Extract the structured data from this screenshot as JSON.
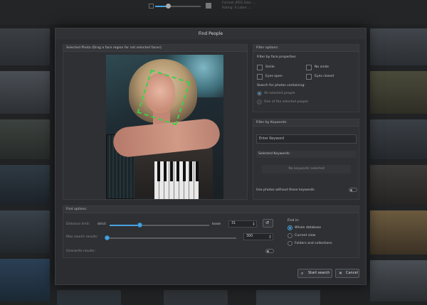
{
  "background": {
    "info_lines": [
      "Format: JPEG   Size: ...",
      "Rating: 0   Label: ..."
    ]
  },
  "dialog": {
    "title": "Find People",
    "photo_panel": {
      "header": "Selected Photo (Drag a face region for not selected faces):"
    },
    "filter_options": {
      "header": "Filter options:",
      "face_props_label": "Filter by face properties",
      "checkboxes": [
        {
          "label": "Smile",
          "checked": false
        },
        {
          "label": "No smile",
          "checked": false
        },
        {
          "label": "Eyes open",
          "checked": false
        },
        {
          "label": "Eyes closed",
          "checked": false
        }
      ],
      "search_label": "Search for photos containing:",
      "radios": [
        {
          "label": "All selected people",
          "selected": true
        },
        {
          "label": "One of the selected people",
          "selected": false
        }
      ]
    },
    "keywords": {
      "header": "Filter by Keywords:",
      "input_placeholder": "Enter Keyword",
      "selected_label": "Selected Keywords:",
      "empty_text": "No keywords selected",
      "toggle_label": "Use photos without these keywords",
      "toggle_on": false
    },
    "find_options": {
      "header": "Find options:",
      "distance_label": "Distance limit:",
      "strict_label": "strict",
      "loose_label": "loose",
      "distance_value": "31",
      "distance_fraction": 0.31,
      "max_results_label": "Max search results:",
      "max_results_value": "300",
      "max_results_fraction": 0.0,
      "overwrite_label": "Overwrite results:",
      "overwrite_on": false,
      "find_in_label": "Find in:",
      "find_in": [
        {
          "label": "Whole database",
          "selected": true
        },
        {
          "label": "Current view",
          "selected": false
        },
        {
          "label": "Folders and collections",
          "selected": false
        }
      ]
    },
    "buttons": {
      "start_label": "Start search",
      "cancel_label": "Cancel"
    }
  }
}
